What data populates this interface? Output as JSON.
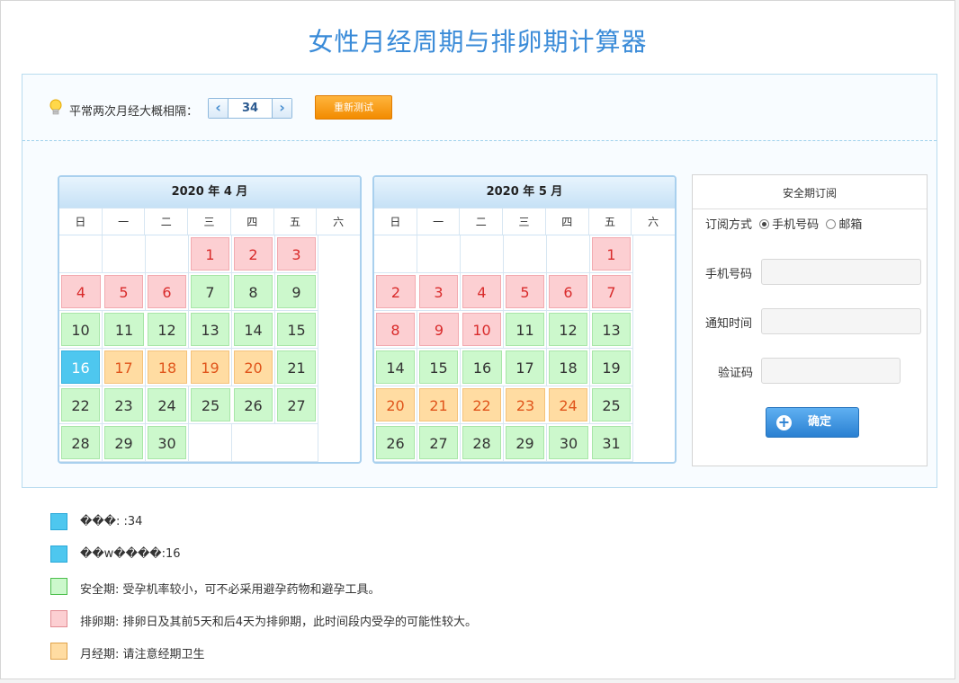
{
  "title": "女性月经周期与排卵期计算器",
  "settings": {
    "interval_label": "平常两次月经大概相隔：",
    "interval_value": "34",
    "prev_label": "‹",
    "next_label": "›",
    "retest_label": "重新测试"
  },
  "weekdays": [
    "日",
    "一",
    "二",
    "三",
    "四",
    "五",
    "六"
  ],
  "calendars": [
    {
      "header": "2020 年 4 月",
      "lead_blanks": 3,
      "days": [
        {
          "d": "1",
          "t": "ovu"
        },
        {
          "d": "2",
          "t": "ovu"
        },
        {
          "d": "3",
          "t": "ovu"
        },
        {
          "d": "4",
          "t": "ovu"
        },
        {
          "d": "5",
          "t": "ovu"
        },
        {
          "d": "6",
          "t": "ovu"
        },
        {
          "d": "7",
          "t": "safe"
        },
        {
          "d": "8",
          "t": "safe"
        },
        {
          "d": "9",
          "t": "safe"
        },
        {
          "d": "10",
          "t": "safe"
        },
        {
          "d": "11",
          "t": "safe"
        },
        {
          "d": "12",
          "t": "safe"
        },
        {
          "d": "13",
          "t": "safe"
        },
        {
          "d": "14",
          "t": "safe"
        },
        {
          "d": "15",
          "t": "safe"
        },
        {
          "d": "16",
          "t": "today"
        },
        {
          "d": "17",
          "t": "mens"
        },
        {
          "d": "18",
          "t": "mens"
        },
        {
          "d": "19",
          "t": "mens"
        },
        {
          "d": "20",
          "t": "mens"
        },
        {
          "d": "21",
          "t": "safe"
        },
        {
          "d": "22",
          "t": "safe"
        },
        {
          "d": "23",
          "t": "safe"
        },
        {
          "d": "24",
          "t": "safe"
        },
        {
          "d": "25",
          "t": "safe"
        },
        {
          "d": "26",
          "t": "safe"
        },
        {
          "d": "27",
          "t": "safe"
        },
        {
          "d": "28",
          "t": "safe"
        },
        {
          "d": "29",
          "t": "safe"
        },
        {
          "d": "30",
          "t": "safe"
        }
      ]
    },
    {
      "header": "2020 年 5 月",
      "lead_blanks": 5,
      "days": [
        {
          "d": "1",
          "t": "ovu"
        },
        {
          "d": "2",
          "t": "ovu"
        },
        {
          "d": "3",
          "t": "ovu"
        },
        {
          "d": "4",
          "t": "ovu"
        },
        {
          "d": "5",
          "t": "ovu"
        },
        {
          "d": "6",
          "t": "ovu"
        },
        {
          "d": "7",
          "t": "ovu"
        },
        {
          "d": "8",
          "t": "ovu"
        },
        {
          "d": "9",
          "t": "ovu"
        },
        {
          "d": "10",
          "t": "ovu"
        },
        {
          "d": "11",
          "t": "safe"
        },
        {
          "d": "12",
          "t": "safe"
        },
        {
          "d": "13",
          "t": "safe"
        },
        {
          "d": "14",
          "t": "safe"
        },
        {
          "d": "15",
          "t": "safe"
        },
        {
          "d": "16",
          "t": "safe"
        },
        {
          "d": "17",
          "t": "safe"
        },
        {
          "d": "18",
          "t": "safe"
        },
        {
          "d": "19",
          "t": "safe"
        },
        {
          "d": "20",
          "t": "mens"
        },
        {
          "d": "21",
          "t": "mens"
        },
        {
          "d": "22",
          "t": "mens"
        },
        {
          "d": "23",
          "t": "mens"
        },
        {
          "d": "24",
          "t": "mens"
        },
        {
          "d": "25",
          "t": "safe"
        },
        {
          "d": "26",
          "t": "safe"
        },
        {
          "d": "27",
          "t": "safe"
        },
        {
          "d": "28",
          "t": "safe"
        },
        {
          "d": "29",
          "t": "safe"
        },
        {
          "d": "30",
          "t": "safe"
        },
        {
          "d": "31",
          "t": "safe"
        }
      ]
    }
  ],
  "subscribe": {
    "title": "安全期订阅",
    "method_label": "订阅方式",
    "option_phone": "手机号码",
    "option_email": "邮箱",
    "phone_label": "手机号码",
    "time_label": "通知时间",
    "code_label": "验证码",
    "confirm_label": "确定"
  },
  "legend": [
    {
      "color": "blue",
      "text": "���: :34"
    },
    {
      "color": "blue",
      "text": "��w����:16"
    },
    {
      "color": "green",
      "text": "安全期: 受孕机率较小，可不必采用避孕药物和避孕工具。"
    },
    {
      "color": "pink",
      "text": "排卵期: 排卵日及其前5天和后4天为排卵期，此时间段内受孕的可能性较大。"
    },
    {
      "color": "orange",
      "text": "月经期: 请注意经期卫生"
    }
  ],
  "colors": {
    "title": "#3a8bd8",
    "safe": "#ccf8cc",
    "ovulation": "#fccfd2",
    "menstrual": "#ffdca2",
    "today": "#4ec7ef",
    "accent_button": "#f28b00"
  }
}
